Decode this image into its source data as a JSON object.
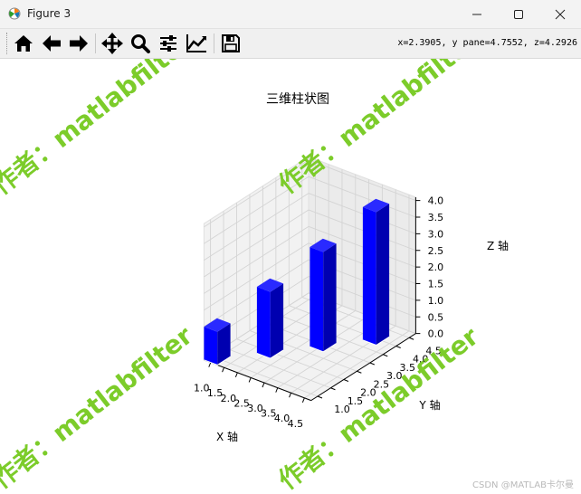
{
  "window": {
    "title": "Figure 3"
  },
  "toolbar": {
    "buttons": [
      {
        "icon": "home-icon",
        "tooltip": "Home"
      },
      {
        "icon": "back-arrow-icon",
        "tooltip": "Back"
      },
      {
        "icon": "forward-arrow-icon",
        "tooltip": "Forward"
      },
      {
        "icon": "pan-icon",
        "tooltip": "Pan"
      },
      {
        "icon": "zoom-icon",
        "tooltip": "Zoom"
      },
      {
        "icon": "configure-subplots-icon",
        "tooltip": "Subplots"
      },
      {
        "icon": "edit-axis-icon",
        "tooltip": "Customize"
      },
      {
        "icon": "save-icon",
        "tooltip": "Save"
      }
    ],
    "coords_text": "x=2.3905, y pane=4.7552, z=4.2926"
  },
  "chart_data": {
    "type": "bar",
    "title": "三维柱状图",
    "xlabel": "X 轴",
    "ylabel": "Y 轴",
    "zlabel": "Z 轴",
    "xticks": [
      "1.0",
      "1.5",
      "2.0",
      "2.5",
      "3.0",
      "3.5",
      "4.0",
      "4.5"
    ],
    "yticks": [
      "1.0",
      "1.5",
      "2.0",
      "2.5",
      "3.0",
      "3.5",
      "4.0",
      "4.5"
    ],
    "zticks": [
      "0.0",
      "0.5",
      "1.0",
      "1.5",
      "2.0",
      "2.5",
      "3.0",
      "3.5",
      "4.0"
    ],
    "xlim": [
      1.0,
      4.5
    ],
    "ylim": [
      1.0,
      4.5
    ],
    "zlim": [
      0,
      4
    ],
    "grid": true,
    "bar_color": "#0000ff",
    "bars": [
      {
        "x": 1,
        "y": 1,
        "z": 1
      },
      {
        "x": 2,
        "y": 2,
        "z": 2
      },
      {
        "x": 3,
        "y": 3,
        "z": 3
      },
      {
        "x": 4,
        "y": 4,
        "z": 4
      }
    ]
  },
  "watermark": {
    "text": "作者：matlabfilter",
    "color": "#7ccc2a"
  },
  "footer": {
    "credit": "CSDN @MATLAB卡尔曼"
  }
}
